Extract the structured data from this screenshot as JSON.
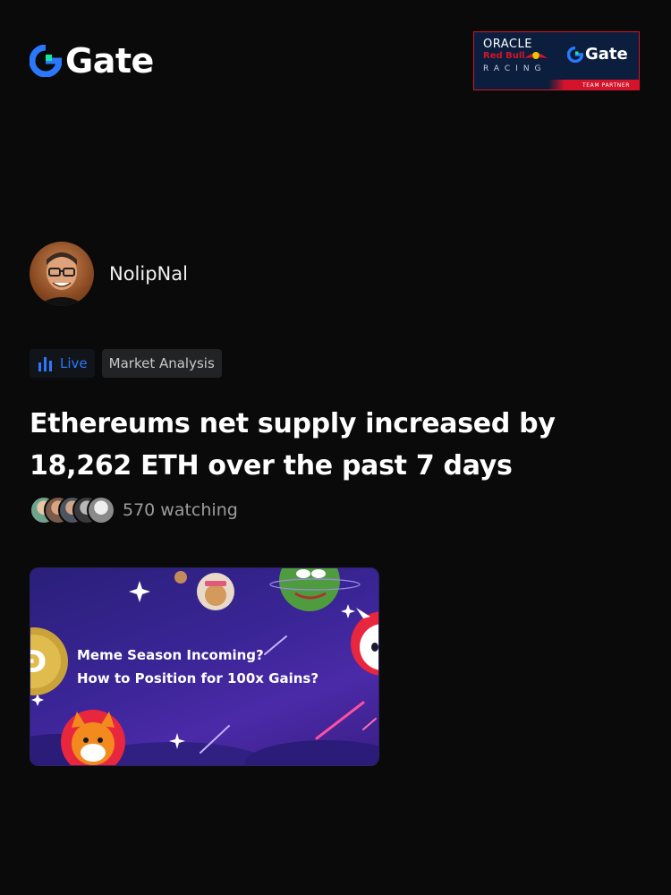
{
  "header": {
    "brand": "Gate",
    "partner_badge": {
      "oracle": "ORACLE",
      "red_bull": "Red Bull",
      "racing": "RACING",
      "brand": "Gate",
      "label": "TEAM PARTNER"
    }
  },
  "author": {
    "name": "NolipNal"
  },
  "tags": {
    "live_label": "Live",
    "category": "Market Analysis"
  },
  "headline": "Ethereums net supply increased by 18,262 ETH over the past 7 days",
  "watchers": {
    "count_text": "570 watching"
  },
  "banner": {
    "line1": "Meme Season Incoming?",
    "line2": "How to Position for 100x Gains?"
  },
  "colors": {
    "background": "#0a0a0a",
    "brand_blue": "#2b78ff",
    "brand_green": "#17e6a1",
    "live_blue": "#2b78ff",
    "partner_red": "#d4142a"
  }
}
